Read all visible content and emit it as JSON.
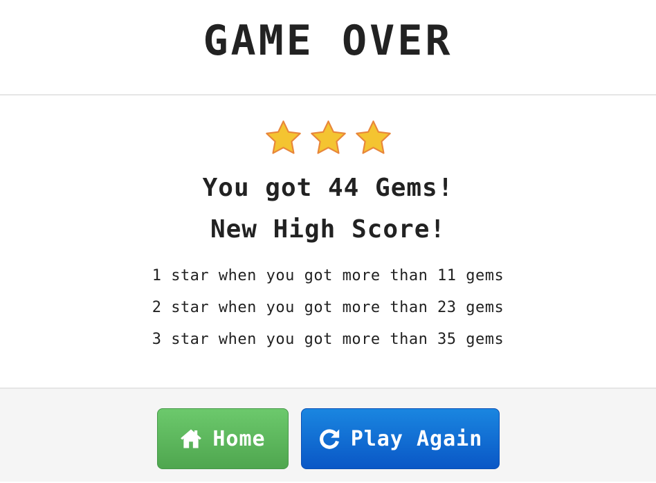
{
  "header": {
    "title": "GAME OVER"
  },
  "body": {
    "stars_earned": 3,
    "stars_total": 3,
    "star_color": "#f4c431",
    "star_outline_color": "#e8863a",
    "result_text": "You got 44 Gems!",
    "highscore_text": "New High Score!",
    "rules": [
      "1 star when you got more than 11 gems",
      "2 star when you got more than 23 gems",
      "3 star when you got more than 35 gems"
    ]
  },
  "footer": {
    "home_label": "Home",
    "home_icon": "home-icon",
    "home_color": "#5cb85c",
    "play_again_label": "Play Again",
    "play_again_icon": "refresh-icon",
    "play_again_color": "#0d6fd6"
  }
}
